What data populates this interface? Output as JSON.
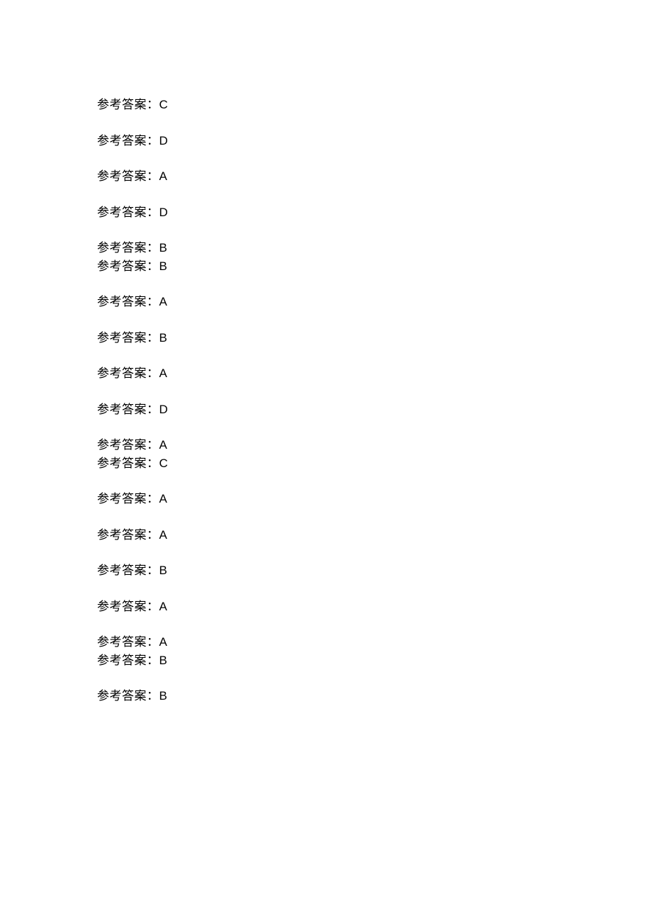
{
  "label": "参考答案：",
  "answers": [
    {
      "value": "C",
      "gapAfter": true
    },
    {
      "value": "D",
      "gapAfter": true
    },
    {
      "value": "A",
      "gapAfter": true
    },
    {
      "value": "D",
      "gapAfter": true
    },
    {
      "value": "B",
      "gapAfter": false
    },
    {
      "value": "B",
      "gapAfter": true
    },
    {
      "value": "A",
      "gapAfter": true
    },
    {
      "value": "B",
      "gapAfter": true
    },
    {
      "value": "A",
      "gapAfter": true
    },
    {
      "value": "D",
      "gapAfter": true
    },
    {
      "value": "A",
      "gapAfter": false
    },
    {
      "value": "C",
      "gapAfter": true
    },
    {
      "value": "A",
      "gapAfter": true
    },
    {
      "value": "A",
      "gapAfter": true
    },
    {
      "value": "B",
      "gapAfter": true
    },
    {
      "value": "A",
      "gapAfter": true
    },
    {
      "value": "A",
      "gapAfter": false
    },
    {
      "value": "B",
      "gapAfter": true
    },
    {
      "value": "B",
      "gapAfter": false
    }
  ]
}
